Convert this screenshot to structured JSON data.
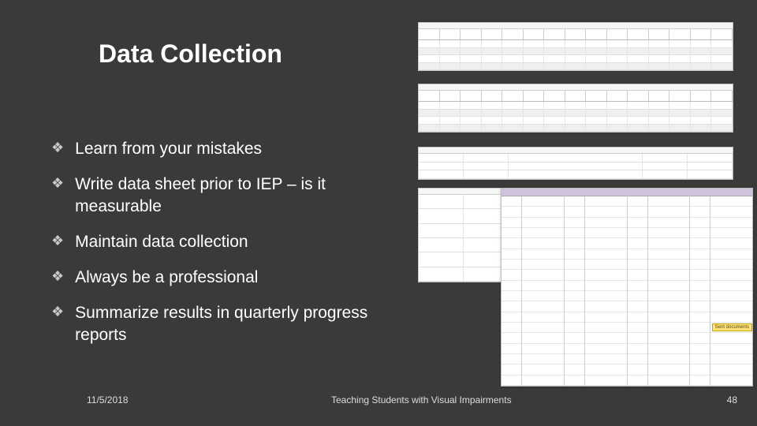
{
  "title": "Data Collection",
  "bullets": [
    "Learn from your mistakes",
    "Write data sheet prior to IEP – is it measurable",
    "Maintain data collection",
    "Always be a professional",
    "Summarize results in quarterly progress reports"
  ],
  "footer": {
    "date": "11/5/2018",
    "caption": "Teaching Students with Visual Impairments",
    "page": "48"
  },
  "tag": "Sent documents"
}
